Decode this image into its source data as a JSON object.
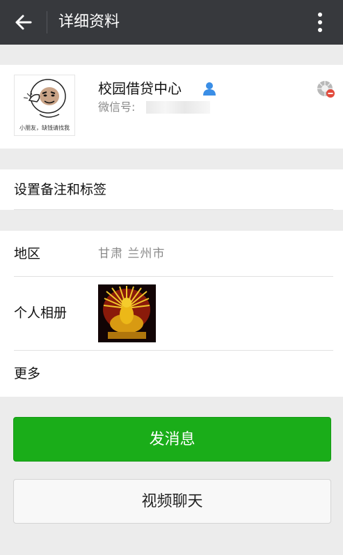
{
  "header": {
    "title": "详细资料",
    "back_icon": "arrow-left-icon",
    "more_icon": "more-vertical-icon"
  },
  "profile": {
    "name": "校园借贷中心",
    "wechat_id_label": "微信号: ",
    "avatar_caption": "小朋友，缺钱请找我",
    "badge_icon": "user-contact-icon",
    "status_icon": "blocked-camera-icon"
  },
  "remark": {
    "label": "设置备注和标签"
  },
  "info": {
    "region_label": "地区",
    "region_value": "甘肃  兰州市",
    "album_label": "个人相册",
    "more_label": "更多"
  },
  "actions": {
    "send_message": "发消息",
    "video_chat": "视频聊天",
    "primary_color": "#1aad19"
  }
}
